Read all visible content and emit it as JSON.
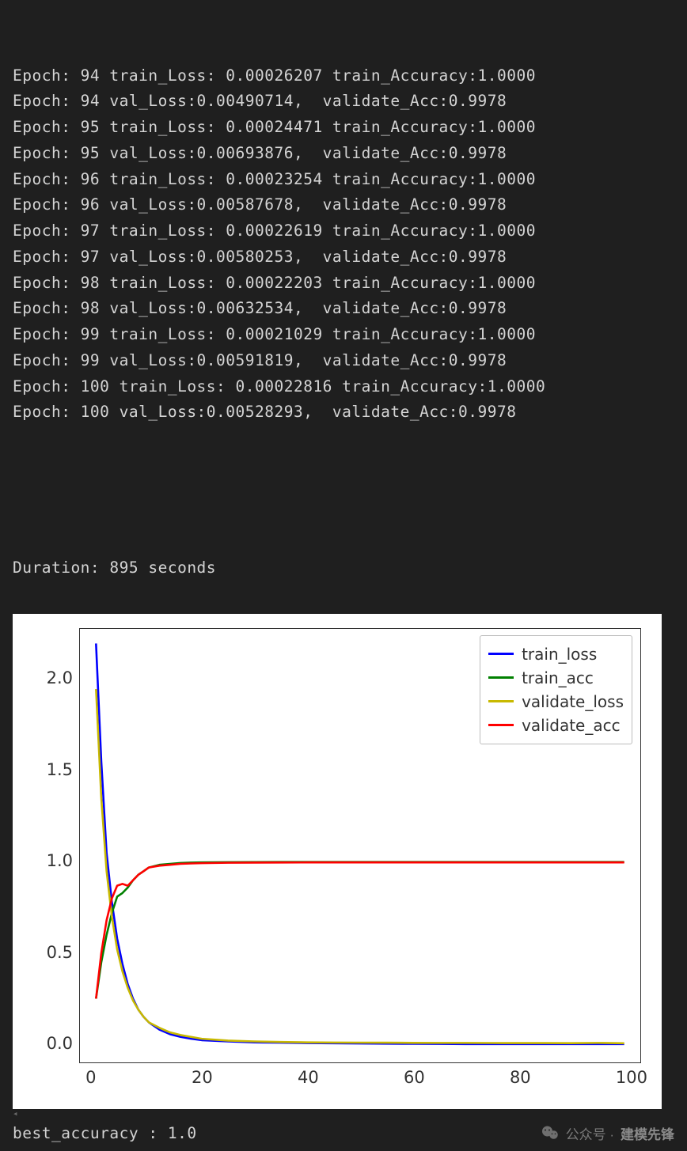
{
  "console": {
    "lines": [
      "Epoch: 94 train_Loss: 0.00026207 train_Accuracy:1.0000",
      "Epoch: 94 val_Loss:0.00490714,  validate_Acc:0.9978",
      "Epoch: 95 train_Loss: 0.00024471 train_Accuracy:1.0000",
      "Epoch: 95 val_Loss:0.00693876,  validate_Acc:0.9978",
      "Epoch: 96 train_Loss: 0.00023254 train_Accuracy:1.0000",
      "Epoch: 96 val_Loss:0.00587678,  validate_Acc:0.9978",
      "Epoch: 97 train_Loss: 0.00022619 train_Accuracy:1.0000",
      "Epoch: 97 val_Loss:0.00580253,  validate_Acc:0.9978",
      "Epoch: 98 train_Loss: 0.00022203 train_Accuracy:1.0000",
      "Epoch: 98 val_Loss:0.00632534,  validate_Acc:0.9978",
      "Epoch: 99 train_Loss: 0.00021029 train_Accuracy:1.0000",
      "Epoch: 99 val_Loss:0.00591819,  validate_Acc:0.9978",
      "Epoch: 100 train_Loss: 0.00022816 train_Accuracy:1.0000",
      "Epoch: 100 val_Loss:0.00528293,  validate_Acc:0.9978"
    ],
    "duration_line": "Duration: 895 seconds"
  },
  "footer": {
    "best_accuracy": "best_accuracy : 1.0",
    "watermark_prefix": "公众号 ·",
    "watermark_brand": "建模先锋"
  },
  "chart_data": {
    "type": "line",
    "title": "",
    "xlabel": "",
    "ylabel": "",
    "xlim": [
      -3,
      103
    ],
    "ylim": [
      -0.1,
      2.28
    ],
    "xticks": [
      0,
      20,
      40,
      60,
      80,
      100
    ],
    "yticks": [
      0.0,
      0.5,
      1.0,
      1.5,
      2.0
    ],
    "ytick_labels": [
      "0.0",
      "0.5",
      "1.0",
      "1.5",
      "2.0"
    ],
    "legend": [
      "train_loss",
      "train_acc",
      "validate_loss",
      "validate_acc"
    ],
    "legend_colors": [
      "#0000ff",
      "#008000",
      "#c8b900",
      "#ff0000"
    ],
    "x": [
      0,
      1,
      2,
      3,
      4,
      5,
      6,
      7,
      8,
      9,
      10,
      12,
      14,
      16,
      18,
      20,
      25,
      30,
      35,
      40,
      45,
      50,
      55,
      60,
      65,
      70,
      75,
      80,
      85,
      90,
      95,
      100
    ],
    "series": [
      {
        "name": "train_loss",
        "color": "#0000ff",
        "values": [
          2.2,
          1.55,
          1.05,
          0.78,
          0.58,
          0.44,
          0.33,
          0.25,
          0.19,
          0.15,
          0.12,
          0.08,
          0.055,
          0.04,
          0.03,
          0.022,
          0.015,
          0.01,
          0.008,
          0.006,
          0.005,
          0.004,
          0.003,
          0.002,
          0.0015,
          0.001,
          0.0008,
          0.0006,
          0.0005,
          0.0004,
          0.00024,
          0.00023
        ]
      },
      {
        "name": "train_acc",
        "color": "#008000",
        "values": [
          0.25,
          0.45,
          0.6,
          0.72,
          0.81,
          0.83,
          0.86,
          0.9,
          0.93,
          0.95,
          0.97,
          0.985,
          0.99,
          0.995,
          0.997,
          0.998,
          0.999,
          0.9995,
          0.9998,
          0.9999,
          1.0,
          1.0,
          1.0,
          1.0,
          1.0,
          1.0,
          1.0,
          1.0,
          1.0,
          1.0,
          1.0,
          1.0
        ]
      },
      {
        "name": "validate_loss",
        "color": "#c8b900",
        "values": [
          1.95,
          1.35,
          0.95,
          0.7,
          0.52,
          0.4,
          0.31,
          0.24,
          0.19,
          0.15,
          0.12,
          0.09,
          0.065,
          0.05,
          0.04,
          0.03,
          0.02,
          0.015,
          0.012,
          0.01,
          0.009,
          0.0085,
          0.008,
          0.0075,
          0.007,
          0.0068,
          0.0065,
          0.0062,
          0.006,
          0.0058,
          0.0069,
          0.0053
        ]
      },
      {
        "name": "validate_acc",
        "color": "#ff0000",
        "values": [
          0.25,
          0.5,
          0.68,
          0.8,
          0.87,
          0.88,
          0.87,
          0.9,
          0.93,
          0.95,
          0.97,
          0.98,
          0.985,
          0.99,
          0.992,
          0.994,
          0.996,
          0.997,
          0.9975,
          0.9978,
          0.9978,
          0.9978,
          0.9978,
          0.9978,
          0.9978,
          0.9978,
          0.9978,
          0.9978,
          0.9978,
          0.9978,
          0.9978,
          0.9978
        ]
      }
    ]
  }
}
